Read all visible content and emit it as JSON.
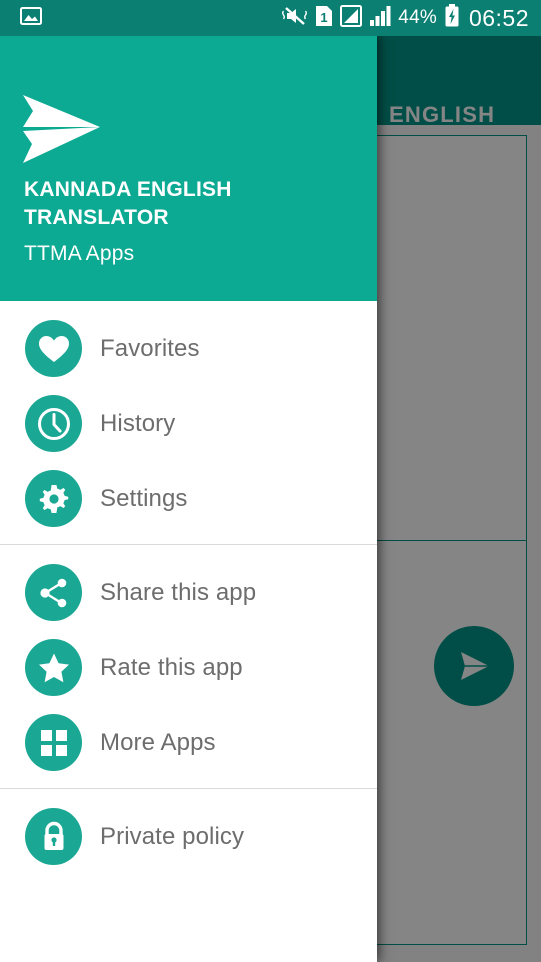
{
  "status_bar": {
    "left_icon": "image-icon",
    "icons": [
      "vibrate-mute-icon",
      "sim1-icon",
      "signal-bars-icon",
      "signal-bars-2-icon"
    ],
    "battery_percent": "44%",
    "battery_icon": "battery-charging-icon",
    "clock": "06:52"
  },
  "background_app": {
    "app_bar_title": "ENGLISH",
    "fab_icon": "send-icon",
    "accent_color": "#009688"
  },
  "drawer": {
    "logo_icon": "paper-plane-icon",
    "title": "KANNADA ENGLISH TRANSLATOR",
    "subtitle": "TTMA Apps",
    "header_color": "#0daa93",
    "groups": [
      {
        "items": [
          {
            "label": "Favorites",
            "icon": "heart-icon"
          },
          {
            "label": "History",
            "icon": "clock-icon"
          },
          {
            "label": "Settings",
            "icon": "gear-icon"
          }
        ]
      },
      {
        "items": [
          {
            "label": "Share this app",
            "icon": "share-icon"
          },
          {
            "label": "Rate this app",
            "icon": "star-icon"
          },
          {
            "label": "More Apps",
            "icon": "grid-apps-icon"
          }
        ]
      },
      {
        "items": [
          {
            "label": "Private policy",
            "icon": "lock-icon"
          }
        ]
      }
    ]
  }
}
